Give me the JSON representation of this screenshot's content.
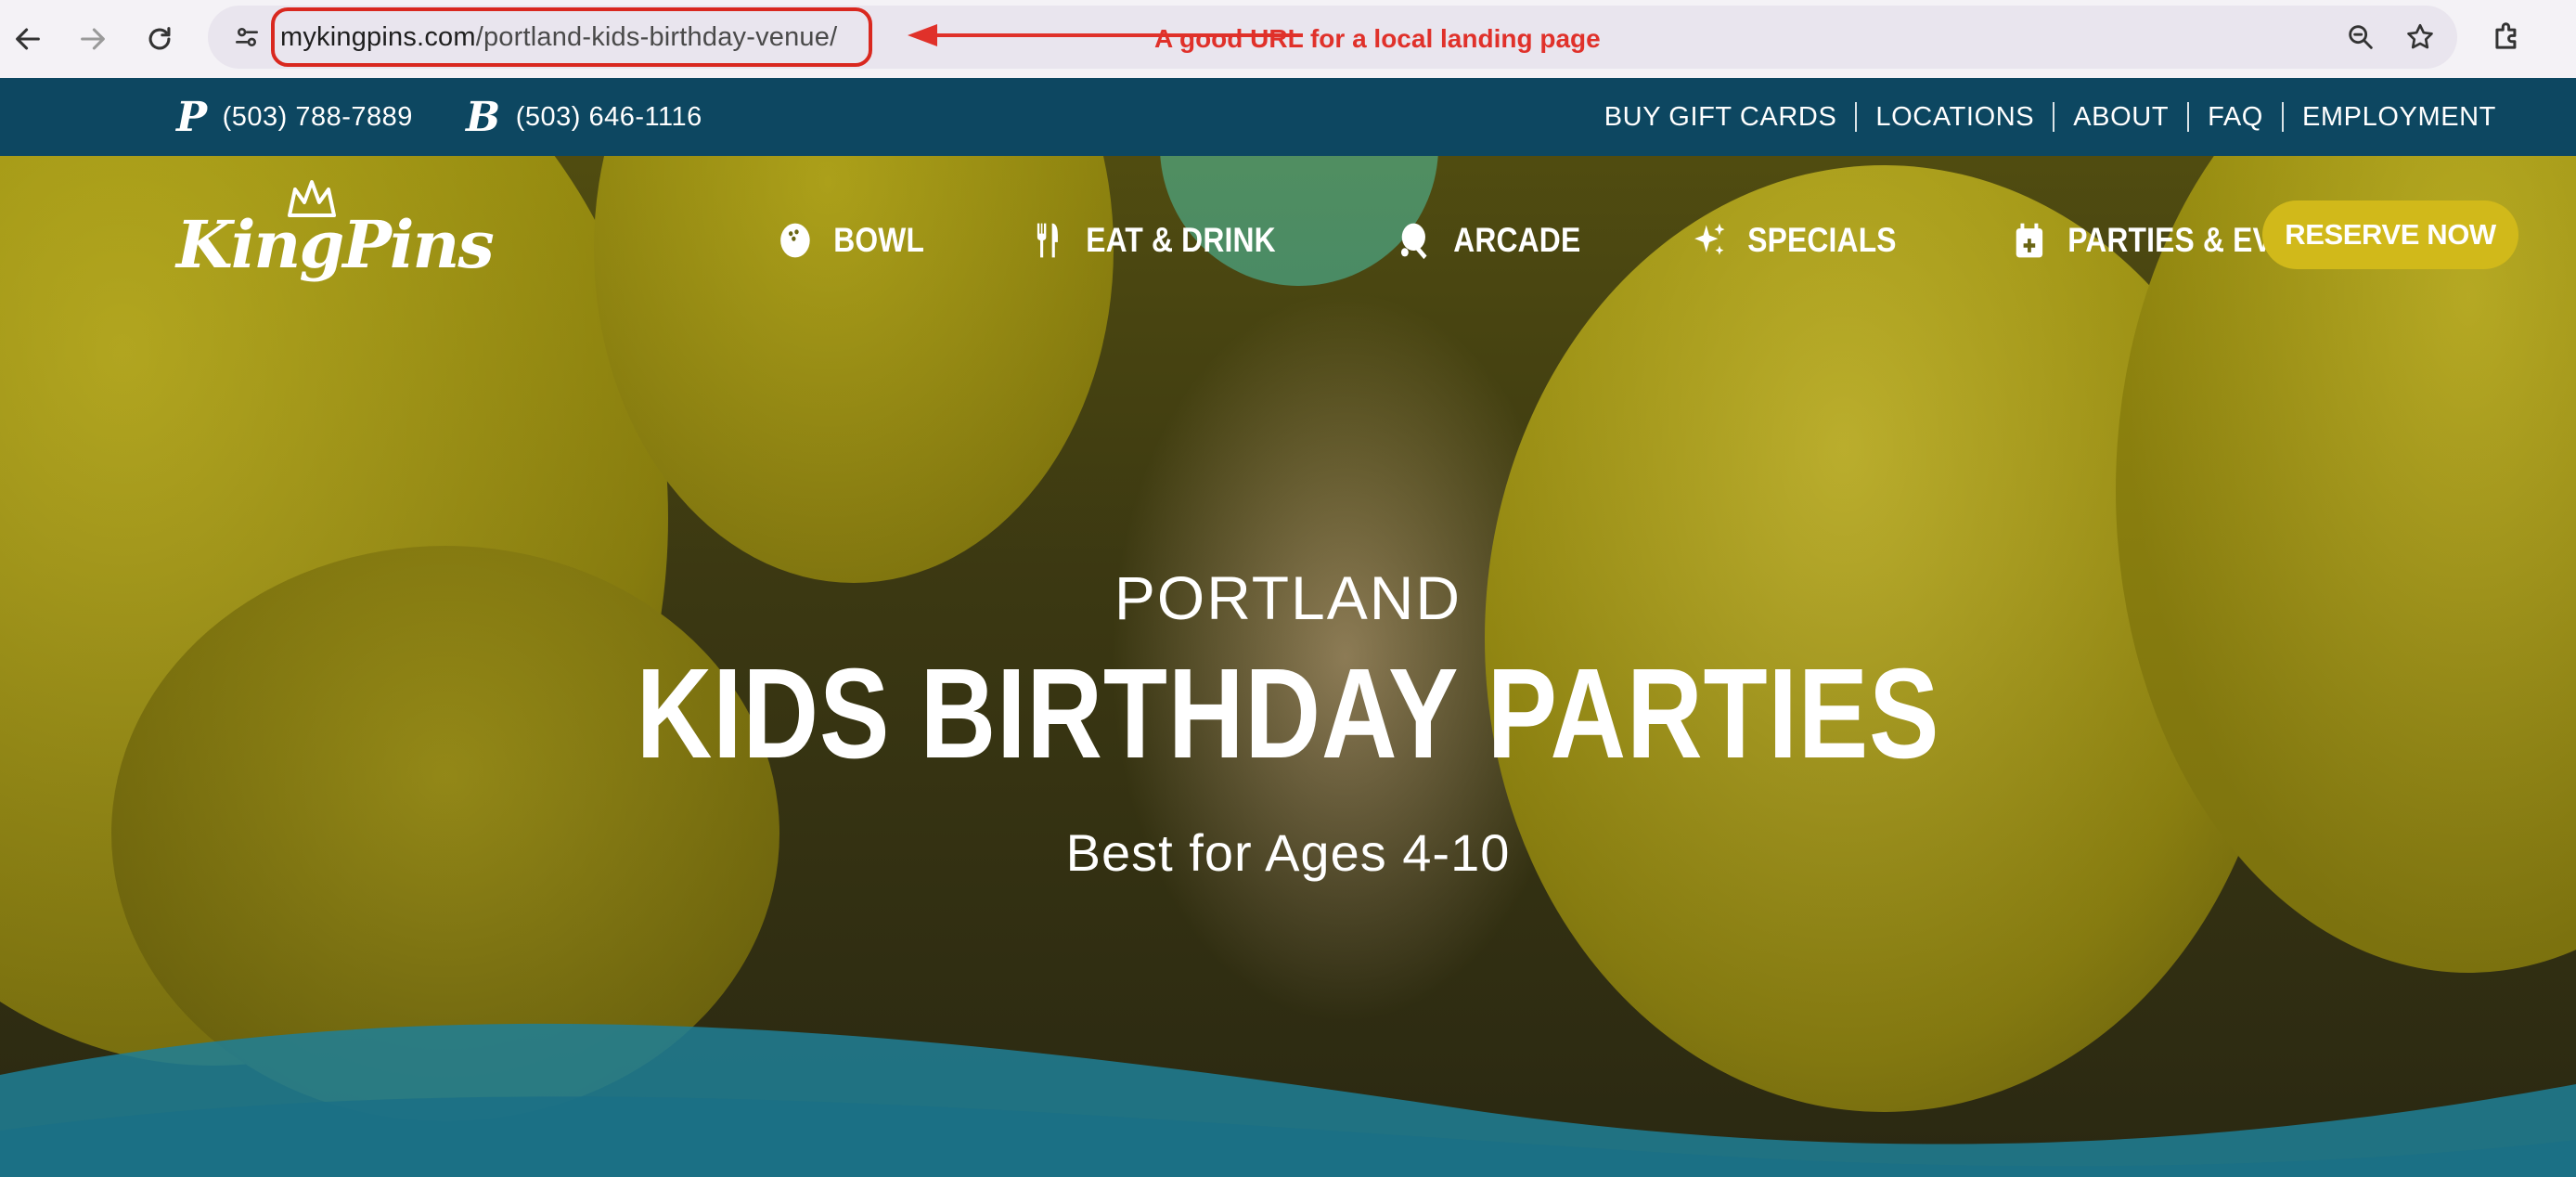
{
  "browser": {
    "url_domain": "mykingpins.com",
    "url_path": "/portland-kids-birthday-venue/",
    "annotation": "A good URL for a local landing page",
    "annotation_color": "#e0312a",
    "icons": [
      "back-arrow-icon",
      "forward-arrow-icon",
      "reload-icon",
      "site-info-icon",
      "zoom-icon",
      "bookmark-star-icon",
      "extensions-icon"
    ]
  },
  "utility_bar": {
    "phones": [
      {
        "icon": "P",
        "number": "(503) 788-7889"
      },
      {
        "icon": "B",
        "number": "(503) 646-1116"
      }
    ],
    "links": [
      "BUY GIFT CARDS",
      "LOCATIONS",
      "ABOUT",
      "FAQ",
      "EMPLOYMENT"
    ],
    "background": "#0d4761"
  },
  "site": {
    "logo_text": "KingPins",
    "nav": [
      "BOWL",
      "EAT & DRINK",
      "ARCADE",
      "SPECIALS",
      "PARTIES & EVENTS"
    ],
    "nav_icons": [
      "bowling-ball-icon",
      "fork-knife-icon",
      "ping-pong-icon",
      "sparkle-icon",
      "calendar-plus-icon"
    ],
    "cta": "RESERVE NOW",
    "cta_color": "#d1b91a"
  },
  "hero": {
    "location": "PORTLAND",
    "title": "KIDS BIRTHDAY PARTIES",
    "tagline": "Best for Ages 4-10",
    "wave_color": "#1e7f97"
  }
}
